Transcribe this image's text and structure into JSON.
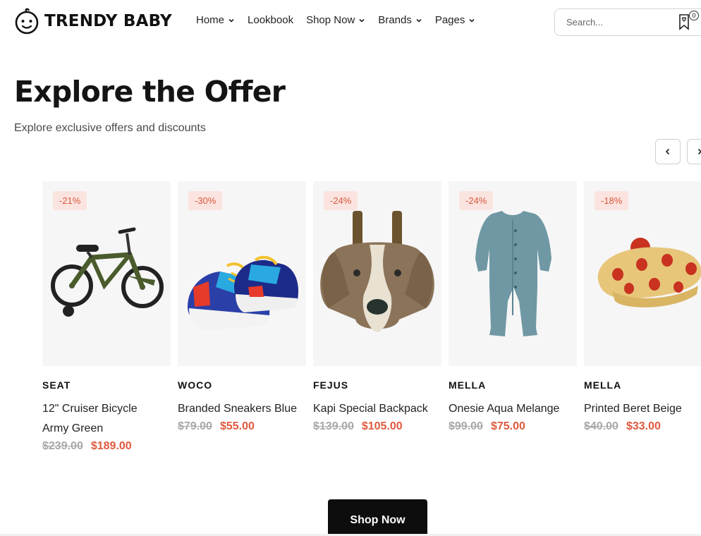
{
  "header": {
    "logo_text": "TRENDY BABY",
    "nav": [
      {
        "label": "Home",
        "dropdown": true
      },
      {
        "label": "Lookbook",
        "dropdown": false
      },
      {
        "label": "Shop Now",
        "dropdown": true
      },
      {
        "label": "Brands",
        "dropdown": true
      },
      {
        "label": "Pages",
        "dropdown": true
      }
    ],
    "search_placeholder": "Search...",
    "wishlist_count": "0"
  },
  "section": {
    "title": "Explore the Offer",
    "subtitle": "Explore exclusive offers and discounts"
  },
  "products": [
    {
      "badge": "-21%",
      "brand": "SEAT",
      "name": "12\" Cruiser Bicycle Army Green",
      "old_price": "$239.00",
      "price": "$189.00",
      "icon": "bicycle-icon"
    },
    {
      "badge": "-30%",
      "brand": "WOCO",
      "name": "Branded Sneakers Blue",
      "old_price": "$79.00",
      "price": "$55.00",
      "icon": "sneakers-icon"
    },
    {
      "badge": "-24%",
      "brand": "FEJUS",
      "name": "Kapi Special Backpack",
      "old_price": "$139.00",
      "price": "$105.00",
      "icon": "dog-backpack-icon"
    },
    {
      "badge": "-24%",
      "brand": "MELLA",
      "name": "Onesie Aqua Melange",
      "old_price": "$99.00",
      "price": "$75.00",
      "icon": "onesie-icon"
    },
    {
      "badge": "-18%",
      "brand": "MELLA",
      "name": "Printed Beret Beige",
      "old_price": "$40.00",
      "price": "$33.00",
      "icon": "beret-icon"
    }
  ],
  "cta": {
    "label": "Shop Now"
  },
  "colors": {
    "accent": "#e0593d",
    "badge_bg": "#fbe4df",
    "dark": "#0d0d0d"
  }
}
